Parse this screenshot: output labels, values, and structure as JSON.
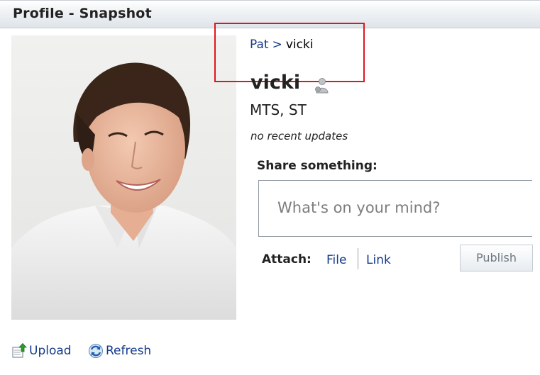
{
  "header": {
    "title": "Profile - Snapshot"
  },
  "photo": {
    "description_icon": "profile-photo"
  },
  "breadcrumb": {
    "parent": "Pat",
    "separator": ">",
    "current": "vicki"
  },
  "profile": {
    "name": "vicki",
    "title": "MTS, ST",
    "status": "no recent updates",
    "presence_icon": "presence-offline-icon"
  },
  "share": {
    "label": "Share something:",
    "placeholder": "What's on your mind?",
    "attach_label": "Attach:",
    "file_link": "File",
    "link_link": "Link",
    "publish_label": "Publish"
  },
  "actions": {
    "upload_label": "Upload",
    "refresh_label": "Refresh"
  },
  "colors": {
    "link": "#143a8a",
    "highlight": "#e0161f"
  }
}
